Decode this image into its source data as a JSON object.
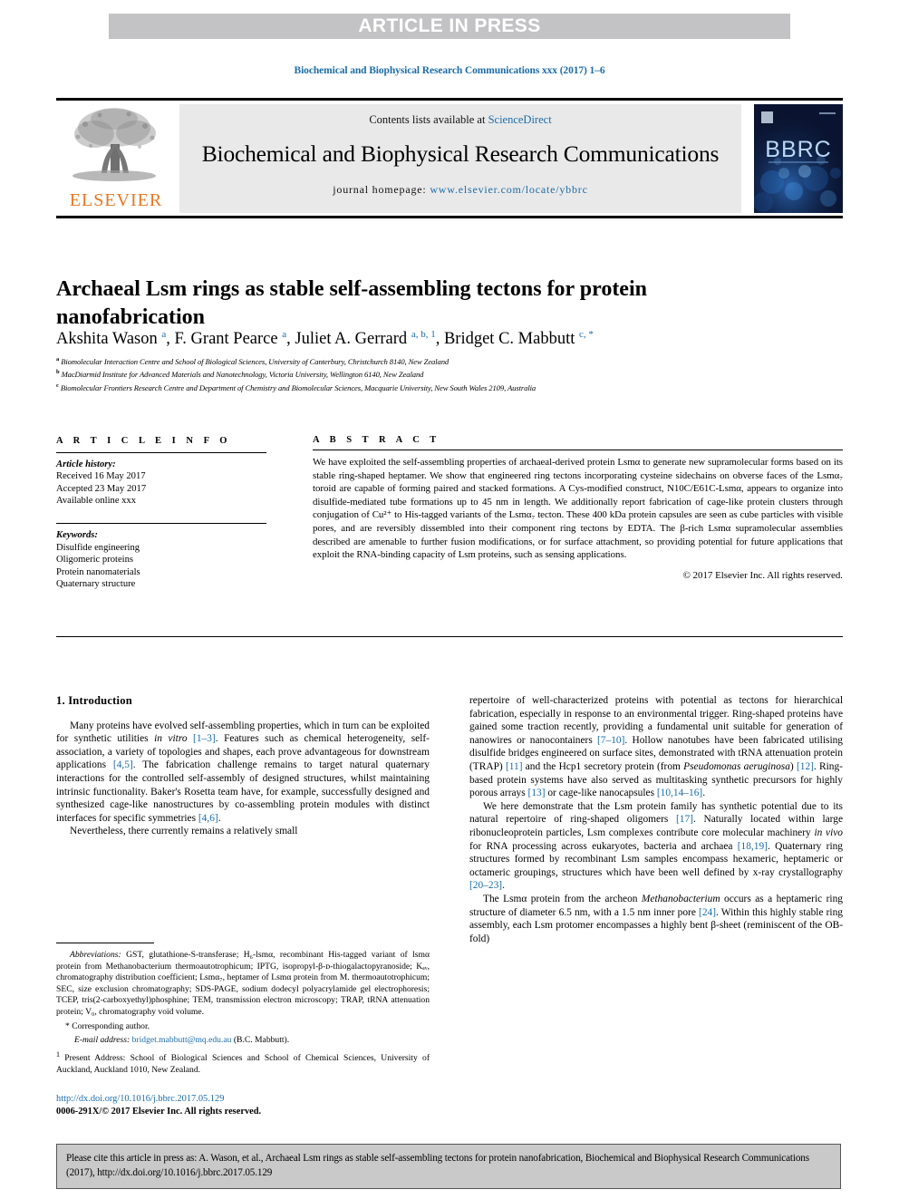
{
  "banner": {
    "label": "ARTICLE IN PRESS"
  },
  "running_head": "Biochemical and Biophysical Research Communications xxx (2017) 1–6",
  "masthead": {
    "contents_prefix": "Contents lists available at ",
    "sciencedirect": "ScienceDirect",
    "journal_title": "Biochemical and Biophysical Research Communications",
    "homepage_prefix": "journal homepage: ",
    "homepage_url": "www.elsevier.com/locate/ybbrc",
    "publisher_wordmark": "ELSEVIER",
    "cover_wordmark": "BBRC",
    "accent_color": "#1b6ca8",
    "banner_gray": "#c3c3c5"
  },
  "article": {
    "title": "Archaeal Lsm rings as stable self-assembling tectons for protein nanofabrication",
    "authors_html": "Akshita Wason <sup>a</sup>, F. Grant Pearce <sup>a</sup>, Juliet A. Gerrard <sup>a, b, 1</sup>, Bridget C. Mabbutt <sup>c, *</sup>",
    "affiliations": [
      {
        "marker": "a",
        "text": "Biomolecular Interaction Centre and School of Biological Sciences, University of Canterbury, Christchurch 8140, New Zealand"
      },
      {
        "marker": "b",
        "text": "MacDiarmid Institute for Advanced Materials and Nanotechnology, Victoria University, Wellington 6140, New Zealand"
      },
      {
        "marker": "c",
        "text": "Biomolecular Frontiers Research Centre and Department of Chemistry and Biomolecular Sciences, Macquarie University, New South Wales 2109, Australia"
      }
    ]
  },
  "article_info": {
    "heading": "A R T I C L E  I N F O",
    "history_label": "Article history:",
    "history": [
      "Received 16 May 2017",
      "Accepted 23 May 2017",
      "Available online xxx"
    ],
    "keywords_label": "Keywords:",
    "keywords": [
      "Disulfide engineering",
      "Oligomeric proteins",
      "Protein nanomaterials",
      "Quaternary structure"
    ]
  },
  "abstract": {
    "heading": "A B S T R A C T",
    "body": "We have exploited the self-assembling properties of archaeal-derived protein Lsmα to generate new supramolecular forms based on its stable ring-shaped heptamer. We show that engineered ring tectons incorporating cysteine sidechains on obverse faces of the Lsmα₇ toroid are capable of forming paired and stacked formations. A Cys-modified construct, N10C/E61C-Lsmα, appears to organize into disulfide-mediated tube formations up to 45 nm in length. We additionally report fabrication of cage-like protein clusters through conjugation of Cu²⁺ to His-tagged variants of the Lsmα₇ tecton. These 400 kDa protein capsules are seen as cube particles with visible pores, and are reversibly dissembled into their component ring tectons by EDTA. The β-rich Lsmα supramolecular assemblies described are amenable to further fusion modifications, or for surface attachment, so providing potential for future applications that exploit the RNA-binding capacity of Lsm proteins, such as sensing applications.",
    "copyright": "© 2017 Elsevier Inc. All rights reserved."
  },
  "body": {
    "section_title": "1. Introduction",
    "left_paragraphs": [
      "Many proteins have evolved self-assembling properties, which in turn can be exploited for synthetic utilities in vitro [1–3]. Features such as chemical heterogeneity, self-association, a variety of topologies and shapes, each prove advantageous for downstream applications [4,5]. The fabrication challenge remains to target natural quaternary interactions for the controlled self-assembly of designed structures, whilst maintaining intrinsic functionality. Baker's Rosetta team have, for example, successfully designed and synthesized cage-like nanostructures by co-assembling protein modules with distinct interfaces for specific symmetries [4,6].",
      "Nevertheless, there currently remains a relatively small"
    ],
    "right_paragraphs": [
      "repertoire of well-characterized proteins with potential as tectons for hierarchical fabrication, especially in response to an environmental trigger. Ring-shaped proteins have gained some traction recently, providing a fundamental unit suitable for generation of nanowires or nanocontainers [7–10]. Hollow nanotubes have been fabricated utilising disulfide bridges engineered on surface sites, demonstrated with tRNA attenuation protein (TRAP) [11] and the Hcp1 secretory protein (from Pseudomonas aeruginosa) [12]. Ring-based protein systems have also served as multitasking synthetic precursors for highly porous arrays [13] or cage-like nanocapsules [10,14–16].",
      "We here demonstrate that the Lsm protein family has synthetic potential due to its natural repertoire of ring-shaped oligomers [17]. Naturally located within large ribonucleoprotein particles, Lsm complexes contribute core molecular machinery in vivo for RNA processing across eukaryotes, bacteria and archaea [18,19]. Quaternary ring structures formed by recombinant Lsm samples encompass hexameric, heptameric or octameric groupings, structures which have been well defined by x-ray crystallography [20–23].",
      "The Lsmα protein from the archeon Methanobacterium occurs as a heptameric ring structure of diameter 6.5 nm, with a 1.5 nm inner pore [24]. Within this highly stable ring assembly, each Lsm protomer encompasses a highly bent β-sheet (reminiscent of the OB-fold)"
    ]
  },
  "footnotes": {
    "abbreviations_label": "Abbreviations:",
    "abbreviations_text": "GST, glutathione-S-transferase; H₆-lsmα, recombinant His-tagged variant of lsmα protein from Methanobacterium thermoautotrophicum; IPTG, isopropyl-β-ᴅ-thiogalactopyranoside; Kₐᵥ, chromatography distribution coefficient; Lsmα₇, heptamer of Lsmα protein from M. thermoautotrophicum; SEC, size exclusion chromatography; SDS-PAGE, sodium dodecyl polyacrylamide gel electrophoresis; TCEP, tris(2-carboxyethyl)phosphine; TEM, transmission electron microscopy; TRAP, tRNA attenuation protein; V₀, chromatography void volume.",
    "corresponding_author": "Corresponding author.",
    "email_label": "E-mail address:",
    "email": "bridget.mabbutt@mq.edu.au",
    "email_suffix": "(B.C. Mabbutt).",
    "present_address_label": "Present Address:",
    "present_address": "School of Biological Sciences and School of Chemical Sciences, University of Auckland, Auckland 1010, New Zealand."
  },
  "doi_block": {
    "doi_url": "http://dx.doi.org/10.1016/j.bbrc.2017.05.129",
    "issn_line": "0006-291X/© 2017 Elsevier Inc. All rights reserved."
  },
  "cite_box": {
    "text": "Please cite this article in press as: A. Wason, et al., Archaeal Lsm rings as stable self-assembling tectons for protein nanofabrication, Biochemical and Biophysical Research Communications (2017), http://dx.doi.org/10.1016/j.bbrc.2017.05.129"
  }
}
